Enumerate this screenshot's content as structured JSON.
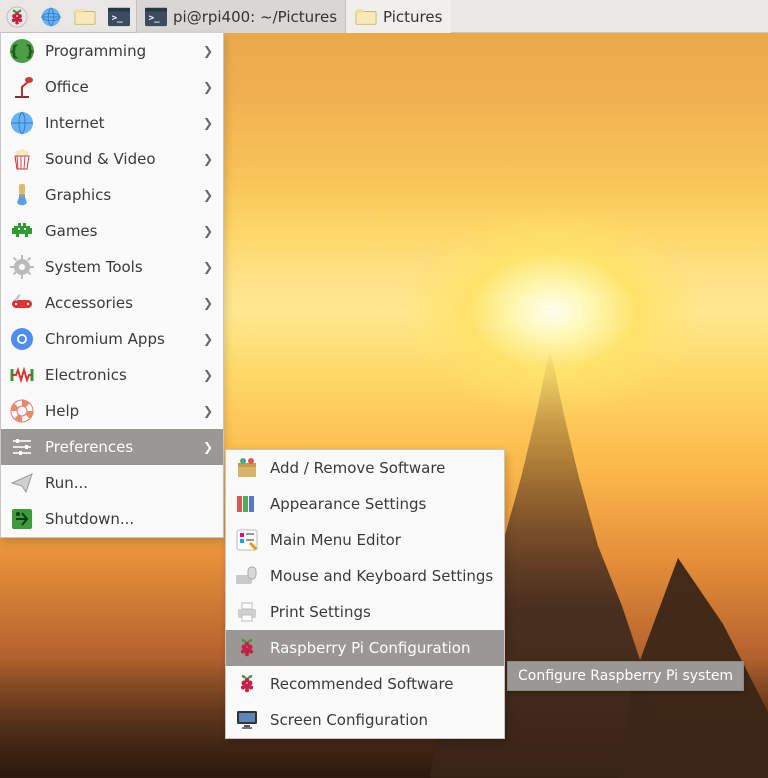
{
  "taskbar": {
    "items": [
      {
        "id": "start",
        "icon": "raspberry-icon"
      },
      {
        "id": "web",
        "icon": "globe-icon"
      },
      {
        "id": "files",
        "icon": "folder-icon"
      },
      {
        "id": "term",
        "icon": "terminal-icon"
      }
    ],
    "tasks": [
      {
        "id": "terminal-window",
        "icon": "terminal-icon",
        "label": "pi@rpi400: ~/Pictures",
        "active": true,
        "highlight": false
      },
      {
        "id": "files-window",
        "icon": "folder-icon",
        "label": "Pictures",
        "active": false,
        "highlight": true
      }
    ]
  },
  "menu": {
    "items": [
      {
        "id": "programming",
        "label": "Programming",
        "icon": "braces-icon",
        "submenu": true
      },
      {
        "id": "office",
        "label": "Office",
        "icon": "desk-lamp-icon",
        "submenu": true
      },
      {
        "id": "internet",
        "label": "Internet",
        "icon": "globe-icon",
        "submenu": true
      },
      {
        "id": "sound-video",
        "label": "Sound & Video",
        "icon": "popcorn-icon",
        "submenu": true
      },
      {
        "id": "graphics",
        "label": "Graphics",
        "icon": "paintbrush-icon",
        "submenu": true
      },
      {
        "id": "games",
        "label": "Games",
        "icon": "invader-icon",
        "submenu": true
      },
      {
        "id": "system-tools",
        "label": "System Tools",
        "icon": "gear-icon",
        "submenu": true
      },
      {
        "id": "accessories",
        "label": "Accessories",
        "icon": "swiss-knife-icon",
        "submenu": true
      },
      {
        "id": "chromium-apps",
        "label": "Chromium Apps",
        "icon": "chromium-icon",
        "submenu": true
      },
      {
        "id": "electronics",
        "label": "Electronics",
        "icon": "resistor-icon",
        "submenu": true
      },
      {
        "id": "help",
        "label": "Help",
        "icon": "lifebuoy-icon",
        "submenu": true
      },
      {
        "id": "preferences",
        "label": "Preferences",
        "icon": "sliders-icon",
        "submenu": true,
        "highlight": true
      },
      {
        "id": "run",
        "label": "Run...",
        "icon": "paper-plane-icon",
        "submenu": false
      },
      {
        "id": "shutdown",
        "label": "Shutdown...",
        "icon": "exit-icon",
        "submenu": false
      }
    ]
  },
  "submenu": {
    "items": [
      {
        "id": "add-remove",
        "label": "Add / Remove Software",
        "icon": "package-icon"
      },
      {
        "id": "appearance",
        "label": "Appearance Settings",
        "icon": "swatches-icon"
      },
      {
        "id": "menu-editor",
        "label": "Main Menu Editor",
        "icon": "menu-editor-icon"
      },
      {
        "id": "mouse-keyboard",
        "label": "Mouse and Keyboard Settings",
        "icon": "mouse-keyboard-icon"
      },
      {
        "id": "print",
        "label": "Print Settings",
        "icon": "printer-icon"
      },
      {
        "id": "rpi-config",
        "label": "Raspberry Pi Configuration",
        "icon": "raspberry-icon",
        "highlight": true
      },
      {
        "id": "recommended",
        "label": "Recommended Software",
        "icon": "raspberry-icon"
      },
      {
        "id": "screen-config",
        "label": "Screen Configuration",
        "icon": "monitor-icon"
      }
    ]
  },
  "tooltip": {
    "text": "Configure Raspberry Pi system"
  }
}
